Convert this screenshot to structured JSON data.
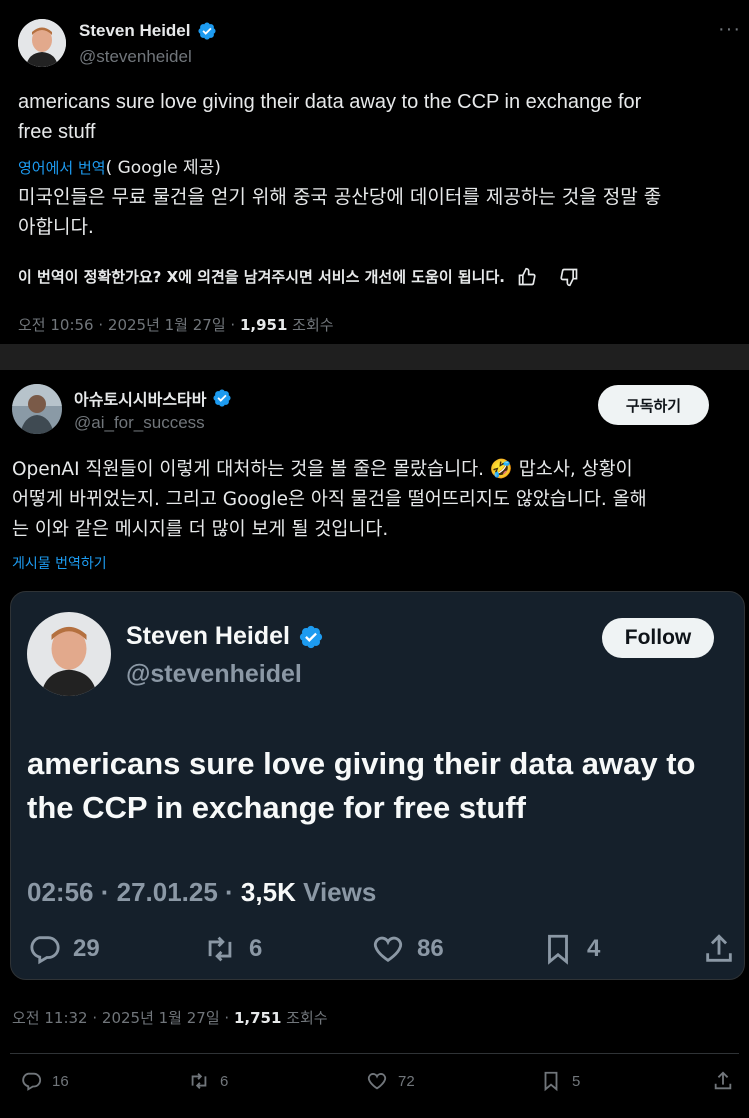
{
  "tweet1": {
    "name": "Steven Heidel",
    "handle": "@stevenheidel",
    "text_line1": "americans sure love giving their data away to the CCP in exchange for",
    "text_line2": "free stuff",
    "translate_label": "영어에서 번역",
    "translate_provider": "( Google 제공)",
    "translated_line1": "미국인들은 무료 물건을 얻기 위해 중국 공산당에 데이터를 제공하는 것을 정말 좋",
    "translated_line2": "아합니다.",
    "feedback_text": "이 번역이 정확한가요? X에 의견을 남겨주시면 서비스 개선에 도움이 됩니다.",
    "time": "오전 10:56 · 2025년 1월 27일 · ",
    "views": "1,951",
    "views_label": " 조회수",
    "more": "···"
  },
  "tweet2": {
    "name": "아슈토시시바스타바",
    "handle": "@ai_for_success",
    "subscribe_label": "구독하기",
    "text_line1": "OpenAI 직원들이 이렇게 대처하는 것을 볼 줄은 몰랐습니다. 🤣 맙소사, 상황이",
    "text_line2": "어떻게 바뀌었는지. 그리고 Google은 아직 물건을 떨어뜨리지도 않았습니다. 올해",
    "text_line3": "는 이와 같은 메시지를 더 많이 보게 될 것입니다.",
    "translate_post": "게시물 번역하기",
    "time": "오전 11:32 · 2025년 1월 27일 · ",
    "views": "1,751",
    "views_label": " 조회수",
    "actions": {
      "replies": "16",
      "retweets": "6",
      "likes": "72",
      "bookmarks": "5"
    }
  },
  "quote": {
    "name": "Steven Heidel",
    "handle": "@stevenheidel",
    "follow_label": "Follow",
    "text_line1": "americans sure love giving their data away to",
    "text_line2": "the CCP in exchange for free stuff",
    "time": "02:56 · 27.01.25 · ",
    "views": "3,5K",
    "views_label": " Views",
    "actions": {
      "replies": "29",
      "retweets": "6",
      "likes": "86",
      "bookmarks": "4"
    }
  },
  "colors": {
    "verified": "#1d9bf0",
    "link": "#1d9bf0",
    "muted": "#71767b"
  }
}
